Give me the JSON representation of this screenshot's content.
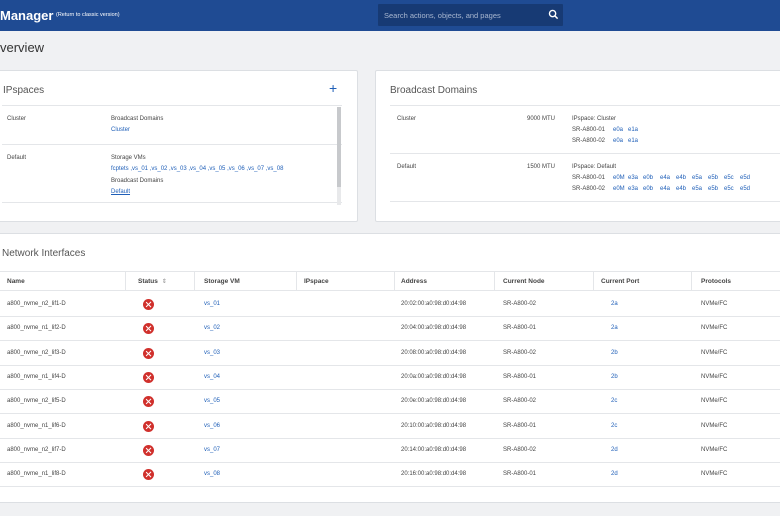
{
  "header": {
    "title": "Manager",
    "classic_link": "(Return to classic version)",
    "search_placeholder": "Search actions, objects, and pages"
  },
  "page_title": "verview",
  "ipspaces": {
    "title": "IPspaces",
    "rows": [
      {
        "name": "Cluster",
        "broadcast_label": "Broadcast Domains",
        "broadcast_value": "Cluster"
      },
      {
        "name": "Default",
        "svm_label": "Storage VMs",
        "svm_value": "fcptets ,vs_01 ,vs_02 ,vs_03 ,vs_04 ,vs_05 ,vs_06 ,vs_07 ,vs_08",
        "broadcast_label": "Broadcast Domains",
        "broadcast_value": "Default"
      }
    ]
  },
  "broadcast_domains": {
    "title": "Broadcast Domains",
    "rows": [
      {
        "name": "Cluster",
        "mtu": "9000 MTU",
        "ipspace": "IPspace: Cluster",
        "nodes": [
          {
            "node": "SR-A800-01",
            "ports": [
              "e0a",
              "e1a"
            ]
          },
          {
            "node": "SR-A800-02",
            "ports": [
              "e0a",
              "e1a"
            ]
          }
        ]
      },
      {
        "name": "Default",
        "mtu": "1500 MTU",
        "ipspace": "IPspace: Default",
        "nodes": [
          {
            "node": "SR-A800-01",
            "ports": [
              "e0M",
              "e3a",
              "e0b",
              "e4a",
              "e4b",
              "e5a",
              "e5b",
              "e5c",
              "e5d"
            ]
          },
          {
            "node": "SR-A800-02",
            "ports": [
              "e0M",
              "e3a",
              "e0b",
              "e4a",
              "e4b",
              "e5a",
              "e5b",
              "e5c",
              "e5d"
            ]
          }
        ]
      }
    ]
  },
  "network_interfaces": {
    "title": "Network Interfaces",
    "columns": [
      "Name",
      "Status",
      "Storage VM",
      "IPspace",
      "Address",
      "Current Node",
      "Current Port",
      "Protocols"
    ],
    "rows": [
      {
        "name": "a800_nvme_n2_lif1-D",
        "status": "error",
        "svm": "vs_01",
        "ipspace": "",
        "address": "20:02:00:a0:98:d0:d4:98",
        "node": "SR-A800-02",
        "port": "2a",
        "protocol": "NVMe/FC"
      },
      {
        "name": "a800_nvme_n1_lif2-D",
        "status": "error",
        "svm": "vs_02",
        "ipspace": "",
        "address": "20:04:00:a0:98:d0:d4:98",
        "node": "SR-A800-01",
        "port": "2a",
        "protocol": "NVMe/FC"
      },
      {
        "name": "a800_nvme_n2_lif3-D",
        "status": "error",
        "svm": "vs_03",
        "ipspace": "",
        "address": "20:08:00:a0:98:d0:d4:98",
        "node": "SR-A800-02",
        "port": "2b",
        "protocol": "NVMe/FC"
      },
      {
        "name": "a800_nvme_n1_lif4-D",
        "status": "error",
        "svm": "vs_04",
        "ipspace": "",
        "address": "20:0a:00:a0:98:d0:d4:98",
        "node": "SR-A800-01",
        "port": "2b",
        "protocol": "NVMe/FC"
      },
      {
        "name": "a800_nvme_n2_lif5-D",
        "status": "error",
        "svm": "vs_05",
        "ipspace": "",
        "address": "20:0e:00:a0:98:d0:d4:98",
        "node": "SR-A800-02",
        "port": "2c",
        "protocol": "NVMe/FC"
      },
      {
        "name": "a800_nvme_n1_lif6-D",
        "status": "error",
        "svm": "vs_06",
        "ipspace": "",
        "address": "20:10:00:a0:98:d0:d4:98",
        "node": "SR-A800-01",
        "port": "2c",
        "protocol": "NVMe/FC"
      },
      {
        "name": "a800_nvme_n2_lif7-D",
        "status": "error",
        "svm": "vs_07",
        "ipspace": "",
        "address": "20:14:00:a0:98:d0:d4:98",
        "node": "SR-A800-02",
        "port": "2d",
        "protocol": "NVMe/FC"
      },
      {
        "name": "a800_nvme_n1_lif8-D",
        "status": "error",
        "svm": "vs_08",
        "ipspace": "",
        "address": "20:16:00:a0:98:d0:d4:98",
        "node": "SR-A800-01",
        "port": "2d",
        "protocol": "NVMe/FC"
      }
    ]
  },
  "colors": {
    "header_bg": "#1f4b93",
    "link": "#1f5fb8",
    "error": "#d0302c"
  },
  "icons": {
    "search": "search-icon",
    "add": "plus-icon",
    "status": "error-circle-icon",
    "sort": "sort-icon"
  }
}
